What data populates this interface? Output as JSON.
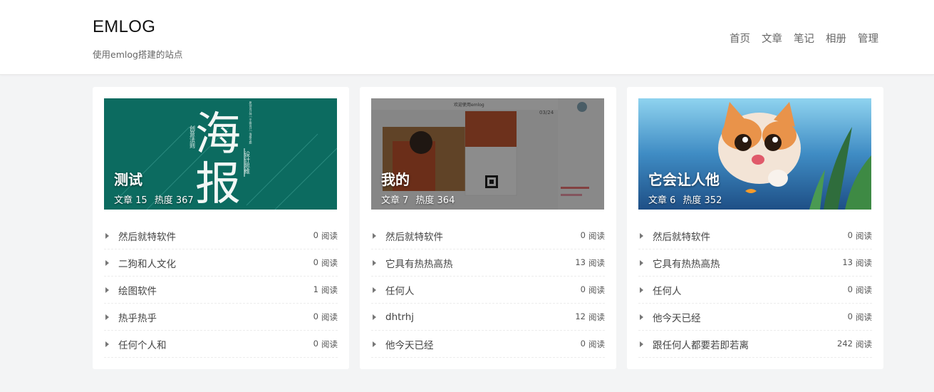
{
  "site": {
    "title": "EMLOG",
    "description": "使用emlog搭建的站点"
  },
  "nav": [
    "首页",
    "文章",
    "笔记",
    "相册",
    "管理"
  ],
  "read_suffix": "阅读",
  "cards": [
    {
      "title": "测试",
      "articles_label": "文章 15",
      "heat_label": "热度 367",
      "poster_big_1": "海",
      "poster_big_2": "报",
      "poster_side_1": "创意法则",
      "poster_side_2": "设计思维",
      "poster_tiny": "原创设计师 | 平面设计 | 海报专题",
      "items": [
        {
          "title": "然后就特软件",
          "reads": "0"
        },
        {
          "title": "二狗和人文化",
          "reads": "0"
        },
        {
          "title": "绘图软件",
          "reads": "1"
        },
        {
          "title": "热乎热乎",
          "reads": "0"
        },
        {
          "title": "任何个人和",
          "reads": "0"
        }
      ]
    },
    {
      "title": "我的",
      "articles_label": "文章 7",
      "heat_label": "热度 364",
      "shot_header": "欢迎使用emlog",
      "shot_page": "03/24",
      "items": [
        {
          "title": "然后就特软件",
          "reads": "0"
        },
        {
          "title": "它具有热热高热",
          "reads": "13"
        },
        {
          "title": "任何人",
          "reads": "0"
        },
        {
          "title": "dhtrhj",
          "reads": "12"
        },
        {
          "title": "他今天已经",
          "reads": "0"
        }
      ]
    },
    {
      "title": "它会让人他",
      "articles_label": "文章 6",
      "heat_label": "热度 352",
      "items": [
        {
          "title": "然后就特软件",
          "reads": "0"
        },
        {
          "title": "它具有热热高热",
          "reads": "13"
        },
        {
          "title": "任何人",
          "reads": "0"
        },
        {
          "title": "他今天已经",
          "reads": "0"
        },
        {
          "title": "跟任何人都要若即若离",
          "reads": "242"
        }
      ]
    }
  ]
}
